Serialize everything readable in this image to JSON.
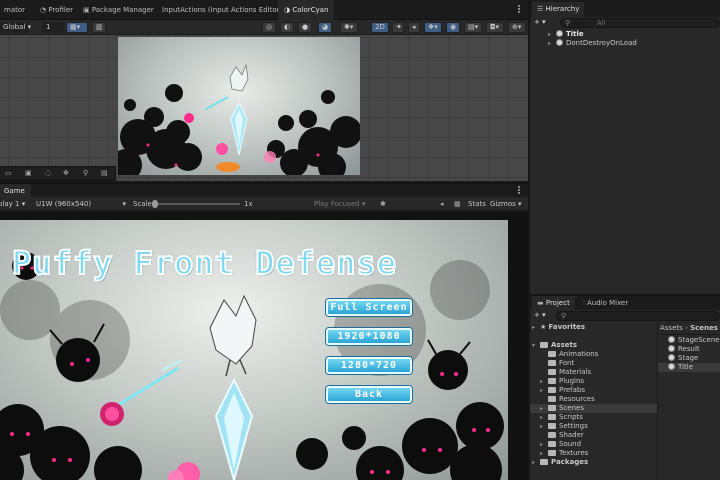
{
  "top_tabs": [
    {
      "label": "mator"
    },
    {
      "label": "Profiler"
    },
    {
      "label": "Package Manager"
    },
    {
      "label": "InputActions (Input Actions Editor)"
    },
    {
      "label": "ColorCyan"
    }
  ],
  "scene_toolbar": {
    "space": "Global",
    "grid_value": "1",
    "mode_2d": "2D"
  },
  "hierarchy": {
    "tab": "Hierarchy",
    "search_placeholder": "All",
    "items": [
      {
        "label": "Title"
      },
      {
        "label": "DontDestroyOnLoad"
      }
    ]
  },
  "game_view": {
    "tab": "Game",
    "display": "play 1",
    "resolution": "U1W (960x540)",
    "scale_label": "Scale",
    "scale_value": "1x",
    "play_focused": "Play Focused",
    "stats": "Stats",
    "gizmos": "Gizmos",
    "title": "Puffy Front Defense",
    "buttons": [
      {
        "label": "Full Screen"
      },
      {
        "label": "1920*1080"
      },
      {
        "label": "1280*720"
      },
      {
        "label": "Back"
      }
    ]
  },
  "project": {
    "tabs": [
      {
        "label": "Project"
      },
      {
        "label": "Audio Mixer"
      }
    ],
    "favorites": "Favorites",
    "assets_root": "Assets",
    "folders": [
      {
        "label": "Animations"
      },
      {
        "label": "Font"
      },
      {
        "label": "Materials"
      },
      {
        "label": "Plugins"
      },
      {
        "label": "Prefabs"
      },
      {
        "label": "Resources"
      },
      {
        "label": "Scenes"
      },
      {
        "label": "Scripts"
      },
      {
        "label": "Settings"
      },
      {
        "label": "Shader"
      },
      {
        "label": "Sound"
      },
      {
        "label": "Textures"
      }
    ],
    "packages": "Packages",
    "breadcrumb_root": "Assets",
    "breadcrumb_sep": "›",
    "breadcrumb_current": "Scenes",
    "files": [
      {
        "label": "StageScene"
      },
      {
        "label": "Result"
      },
      {
        "label": "Stage"
      },
      {
        "label": "Title"
      }
    ]
  },
  "colors": {
    "editor_bg": "#282828",
    "title_text": "#7fd9f2",
    "button_fill": "#3fb5e0"
  }
}
